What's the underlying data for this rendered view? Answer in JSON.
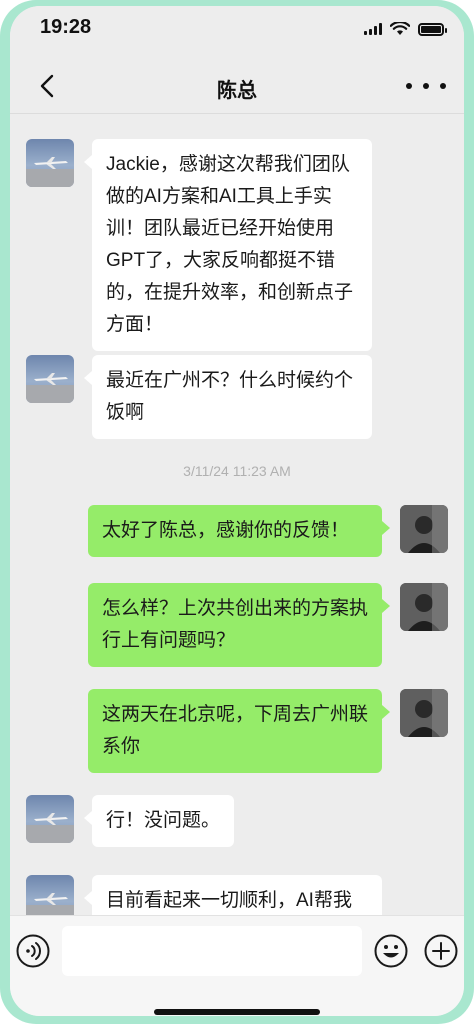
{
  "status_bar": {
    "time": "19:28"
  },
  "header": {
    "title": "陈总"
  },
  "messages": [
    {
      "side": "left",
      "text": "Jackie，感谢这次帮我们团队做的AI方案和AI工具上手实训！团队最近已经开始使用GPT了，大家反响都挺不错的，在提升效率，和创新点子方面！"
    },
    {
      "side": "left",
      "text": "最近在广州不？什么时候约个饭啊"
    },
    {
      "side": "right",
      "text": "太好了陈总，感谢你的反馈！"
    },
    {
      "side": "right",
      "text": "怎么样？上次共创出来的方案执行上有问题吗？"
    },
    {
      "side": "right",
      "text": "这两天在北京呢，下周去广州联系你"
    },
    {
      "side": "left",
      "text": "行！没问题。"
    },
    {
      "side": "left",
      "text": "目前看起来一切顺利，AI帮我"
    }
  ],
  "timestamp": "3/11/24 11:23 AM",
  "colors": {
    "frame": "#a9e7cf",
    "bubble_right": "#95ec69",
    "bubble_left": "#ffffff",
    "background": "#ededed"
  },
  "icons": {
    "back": "chevron-left-icon",
    "more": "more-dots-icon",
    "voice": "voice-icon",
    "emoji": "emoji-icon",
    "plus": "plus-icon"
  }
}
